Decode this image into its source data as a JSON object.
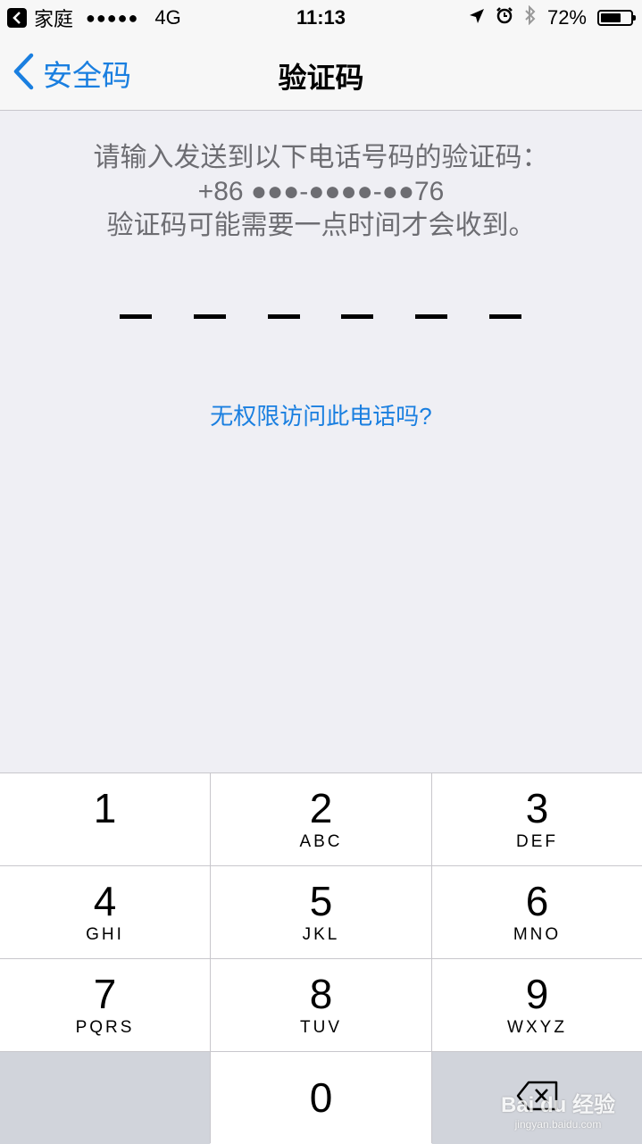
{
  "status_bar": {
    "carrier": "家庭",
    "signal": "●●●●●",
    "network": "4G",
    "time": "11:13",
    "battery": "72%",
    "battery_level": 0.72
  },
  "nav": {
    "back_label": "安全码",
    "title": "验证码"
  },
  "prompt": {
    "line1": "请输入发送到以下电话号码的验证码：",
    "line2": "+86 ●●●-●●●●-●●76",
    "line3": "验证码可能需要一点时间才会收到。"
  },
  "code_length": 6,
  "no_access_link": "无权限访问此电话吗?",
  "keypad": {
    "k1": {
      "num": "1",
      "letters": ""
    },
    "k2": {
      "num": "2",
      "letters": "ABC"
    },
    "k3": {
      "num": "3",
      "letters": "DEF"
    },
    "k4": {
      "num": "4",
      "letters": "GHI"
    },
    "k5": {
      "num": "5",
      "letters": "JKL"
    },
    "k6": {
      "num": "6",
      "letters": "MNO"
    },
    "k7": {
      "num": "7",
      "letters": "PQRS"
    },
    "k8": {
      "num": "8",
      "letters": "TUV"
    },
    "k9": {
      "num": "9",
      "letters": "WXYZ"
    },
    "k0": {
      "num": "0"
    }
  },
  "watermark": {
    "brand": "Bai du 经验",
    "url": "jingyan.baidu.com"
  },
  "colors": {
    "accent": "#1a7fe0",
    "background": "#efeff4",
    "prompt_text": "#6d6d72"
  }
}
